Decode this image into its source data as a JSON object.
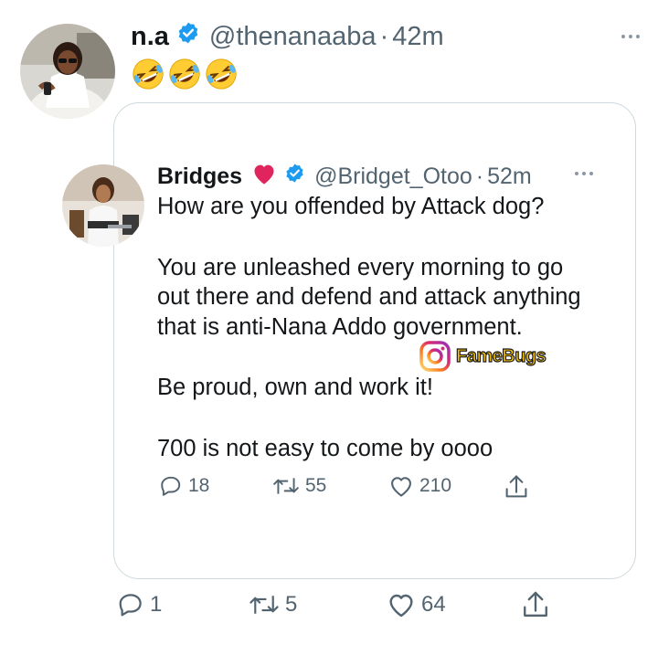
{
  "outer_tweet": {
    "name": "n.a",
    "handle": "@thenanaaba",
    "separator": "·",
    "time": "42m",
    "emoji_text": "🤣🤣🤣",
    "actions": {
      "replies": "1",
      "retweets": "5",
      "likes": "64"
    }
  },
  "quoted_tweet": {
    "name": "Bridges",
    "handle": "@Bridget_Otoo",
    "separator": "·",
    "time": "52m",
    "lines": {
      "l1": "How are you offended by Attack dog?",
      "l2": "You are unleashed every morning to go",
      "l3": "out there and defend and attack anything",
      "l4": "that is anti-Nana Addo government.",
      "l5": "Be proud, own and work it!",
      "l6": "700 is not easy to come by oooo"
    },
    "actions": {
      "replies": "18",
      "retweets": "55",
      "likes": "210"
    }
  },
  "watermark": {
    "text": "FameBugs"
  },
  "colors": {
    "verified": "#1d9bf0",
    "secondary_text": "#536471",
    "border": "#cfd9de",
    "heart_emoji": "#e0245e"
  },
  "icons": [
    "verified-badge-icon",
    "more-icon",
    "reply-icon",
    "retweet-icon",
    "like-icon",
    "share-icon",
    "instagram-icon",
    "rolling-laughing-emoji"
  ]
}
